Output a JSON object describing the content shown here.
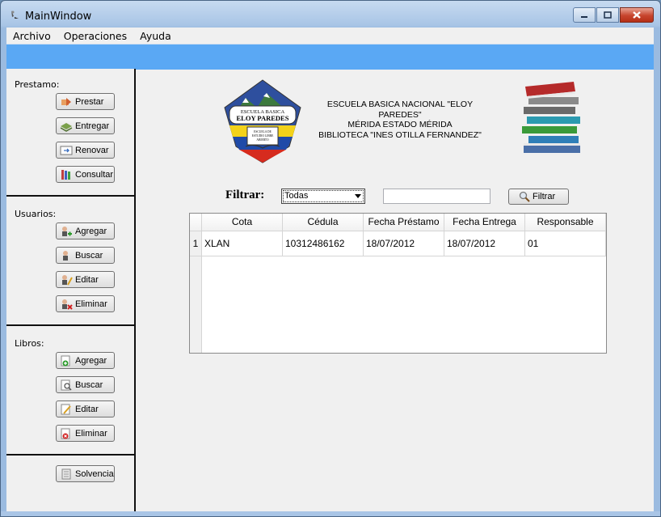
{
  "window": {
    "title": "MainWindow"
  },
  "menu": [
    "Archivo",
    "Operaciones",
    "Ayuda"
  ],
  "sidebar": {
    "prestamo_label": "Prestamo:",
    "prestamo_buttons": [
      "Prestar",
      "Entregar",
      "Renovar",
      "Consultar"
    ],
    "usuarios_label": "Usuarios:",
    "usuarios_buttons": [
      "Agregar",
      "Buscar",
      "Editar",
      "Eliminar"
    ],
    "libros_label": "Libros:",
    "libros_buttons": [
      "Agregar",
      "Buscar",
      "Editar",
      "Eliminar"
    ],
    "solvencia_label": "Solvencia"
  },
  "logo": {
    "line1": "ESCUELA BASICA",
    "line2": "ELOY PAREDES",
    "line3": "ESCUELA DE",
    "line4": "ESTUDIO LIBRE",
    "line5": "ABIERTO"
  },
  "school": {
    "line1": "ESCUELA BASICA NACIONAL \"ELOY PAREDES\"",
    "line2": "MÉRIDA ESTADO MÉRIDA",
    "line3": "BIBLIOTECA \"INES OTILLA FERNANDEZ\""
  },
  "filter": {
    "label": "Filtrar:",
    "selected": "Todas",
    "text_value": "",
    "button_label": "Filtrar"
  },
  "table": {
    "columns": [
      "Cota",
      "Cédula",
      "Fecha Préstamo",
      "Fecha Entrega",
      "Responsable"
    ],
    "rows": [
      {
        "num": "1",
        "cota": "XLAN",
        "cedula": "10312486162",
        "fecha_prestamo": "18/07/2012",
        "fecha_entrega": "18/07/2012",
        "responsable": "01"
      }
    ]
  },
  "colors": {
    "toolbar": "#5aa8f4",
    "titlebar": "#a9c5e6",
    "close_button": "#c7442d"
  }
}
